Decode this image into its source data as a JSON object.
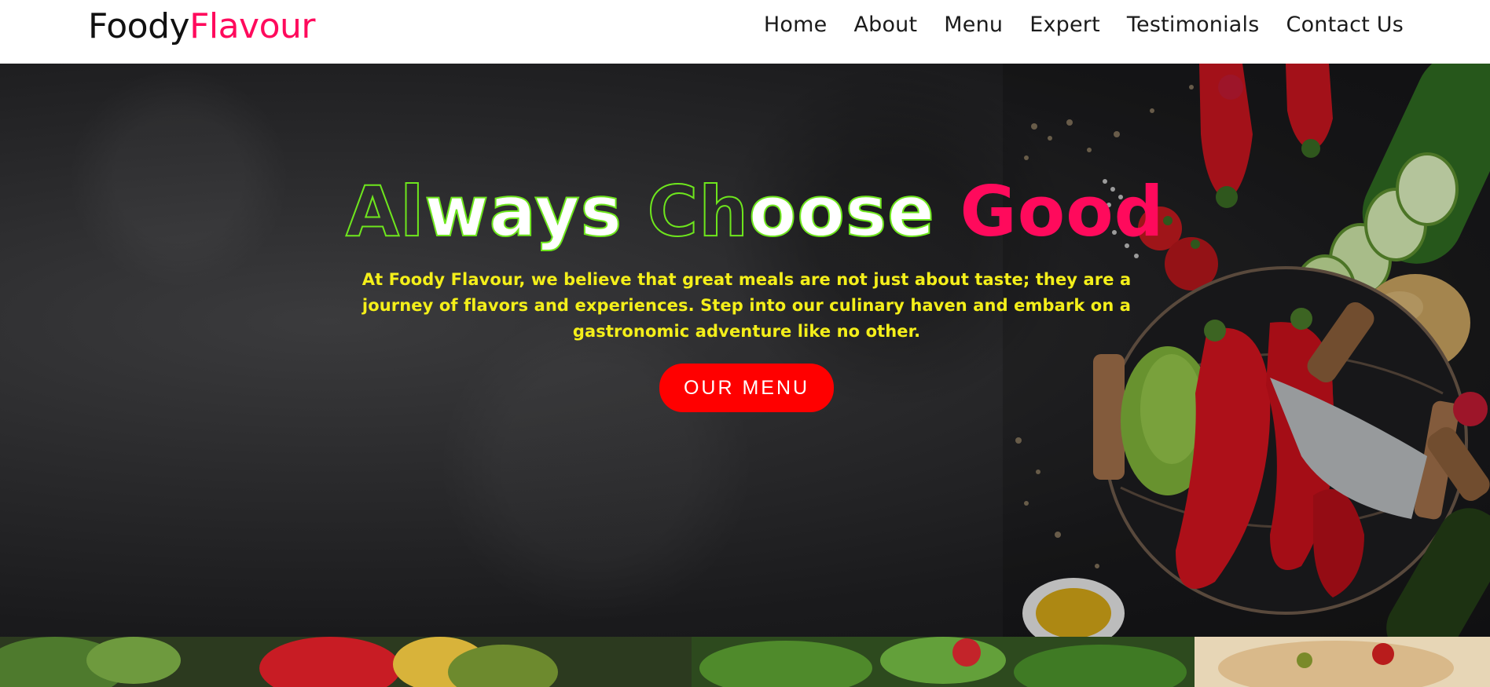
{
  "brand": {
    "part1": "Foody",
    "part2": "Flavour"
  },
  "nav": {
    "items": [
      {
        "label": "Home"
      },
      {
        "label": "About"
      },
      {
        "label": "Menu"
      },
      {
        "label": "Expert"
      },
      {
        "label": "Testimonials"
      },
      {
        "label": "Contact Us"
      }
    ]
  },
  "hero": {
    "headline": {
      "word1_outline": "Al",
      "word1_fill": "ways",
      "word2_outline": "Ch",
      "word2_fill": "oose",
      "word3": "Good"
    },
    "tagline": "At Foody Flavour, we believe that great meals are not just about taste; they are a journey of flavors and experiences. Step into our culinary haven and embark on a gastronomic adventure like no other.",
    "cta_label": "OUR MENU"
  },
  "colors": {
    "brand_accent": "#ff0a5c",
    "headline_outline": "#6ee61d",
    "tagline": "#f4ef1a",
    "cta_background": "#ff0000",
    "navbar_background": "#ffffff"
  }
}
